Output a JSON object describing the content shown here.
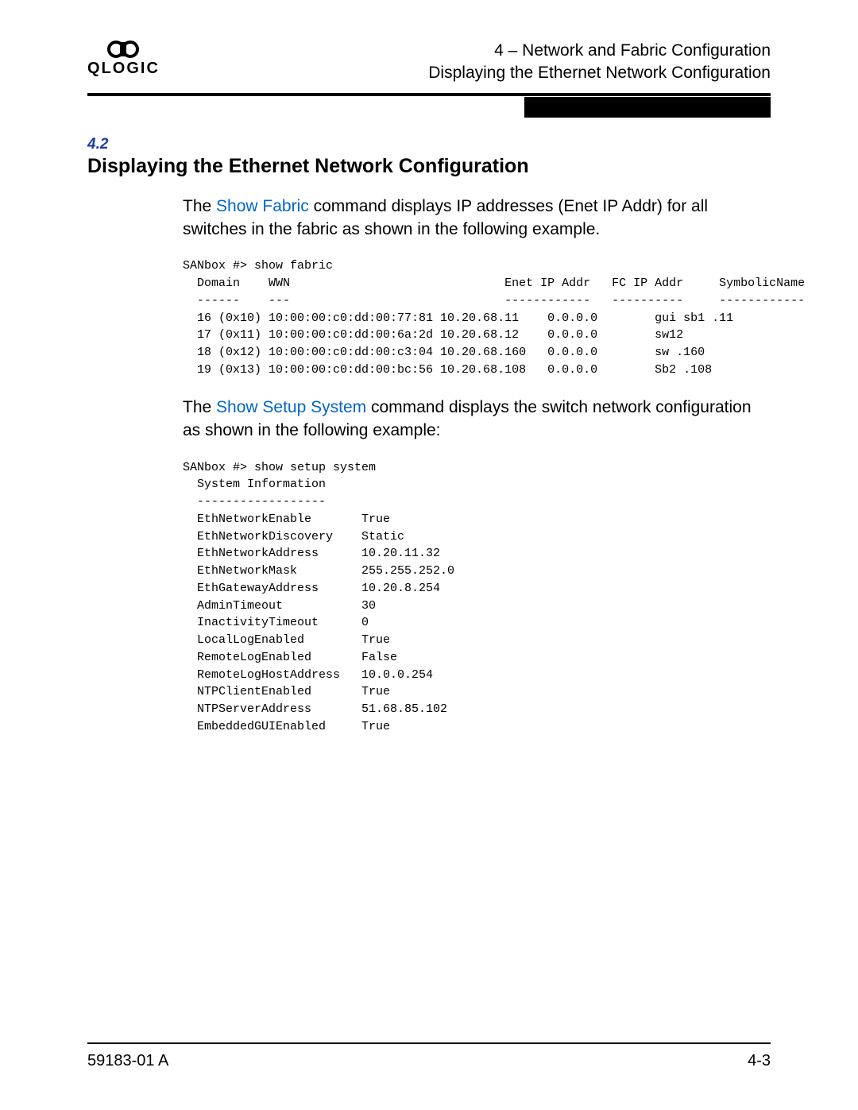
{
  "header": {
    "brand": "QLOGIC",
    "chapter": "4 – Network and Fabric Configuration",
    "subtitle": "Displaying the Ethernet Network Configuration"
  },
  "section": {
    "number": "4.2",
    "title": "Displaying the Ethernet Network Configuration"
  },
  "intro": {
    "pre1": "The ",
    "link1": "Show Fabric",
    "post1": " command displays IP addresses (Enet IP Addr) for all switches in the fabric as shown in the following example."
  },
  "code1": "SANbox #> show fabric\n  Domain    WWN                              Enet IP Addr   FC IP Addr     SymbolicName\n  ------    ---                              ------------   ----------     ------------\n  16 (0x10) 10:00:00:c0:dd:00:77:81 10.20.68.11    0.0.0.0        gui sb1 .11\n  17 (0x11) 10:00:00:c0:dd:00:6a:2d 10.20.68.12    0.0.0.0        sw12\n  18 (0x12) 10:00:00:c0:dd:00:c3:04 10.20.68.160   0.0.0.0        sw .160\n  19 (0x13) 10:00:00:c0:dd:00:bc:56 10.20.68.108   0.0.0.0        Sb2 .108",
  "intro2": {
    "pre1": "The ",
    "link1": "Show Setup System",
    "post1": " command displays the switch network configuration as shown in the following example:"
  },
  "code2": "SANbox #> show setup system\n  System Information\n  ------------------\n  EthNetworkEnable       True\n  EthNetworkDiscovery    Static\n  EthNetworkAddress      10.20.11.32\n  EthNetworkMask         255.255.252.0\n  EthGatewayAddress      10.20.8.254\n  AdminTimeout           30\n  InactivityTimeout      0\n  LocalLogEnabled        True\n  RemoteLogEnabled       False\n  RemoteLogHostAddress   10.0.0.254\n  NTPClientEnabled       True\n  NTPServerAddress       51.68.85.102\n  EmbeddedGUIEnabled     True",
  "footer": {
    "left": "59183-01 A",
    "right": "4-3"
  }
}
